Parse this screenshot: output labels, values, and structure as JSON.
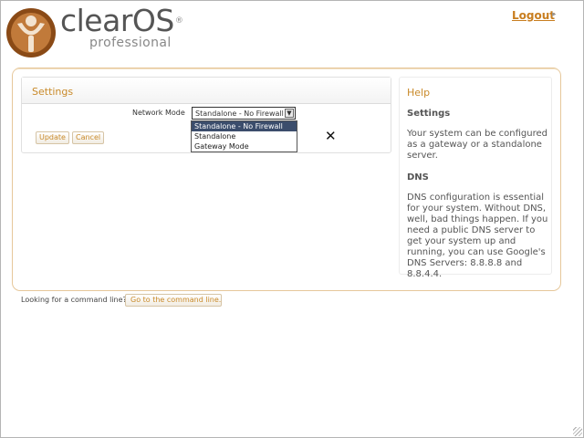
{
  "header": {
    "brand": "clearOS",
    "trademark": "®",
    "edition": "professional",
    "logout_label": "Logout",
    "logout_arrow": "▸"
  },
  "settings": {
    "title": "Settings",
    "network_mode_label": "Network Mode",
    "network_mode_value": "Standalone - No Firewall",
    "options": [
      "Standalone - No Firewall",
      "Standalone",
      "Gateway Mode"
    ],
    "update_label": "Update",
    "cancel_label": "Cancel",
    "close_glyph": "✕"
  },
  "help": {
    "title": "Help",
    "settings_heading": "Settings",
    "settings_text": "Your system can be configured as a gateway or a standalone server.",
    "dns_heading": "DNS",
    "dns_text": "DNS configuration is essential for your system. Without DNS, well, bad things happen. If you need a public DNS server to get your system up and running, you can use Google's DNS Servers: 8.8.8.8 and 8.8.4.4."
  },
  "command_line": {
    "prompt": "Looking for a command line?",
    "button_label": "Go to the command line..."
  },
  "colors": {
    "accent": "#c98a2a",
    "logo_brown": "#8a4a16",
    "selected_option": "#3b4d6c"
  }
}
